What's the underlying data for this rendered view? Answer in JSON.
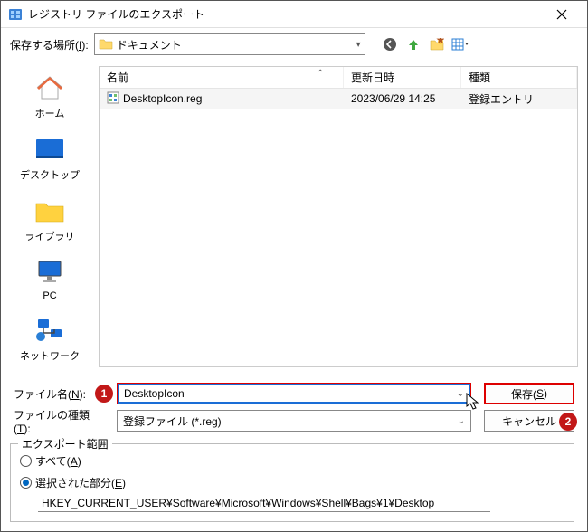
{
  "window": {
    "title": "レジストリ ファイルのエクスポート"
  },
  "toolbar": {
    "location_label_pre": "保存する場所(",
    "location_label_key": "I",
    "location_label_post": "):",
    "location_value": "ドキュメント"
  },
  "places": {
    "home": "ホーム",
    "desktop": "デスクトップ",
    "libraries": "ライブラリ",
    "pc": "PC",
    "network": "ネットワーク"
  },
  "filelist": {
    "col_name": "名前",
    "col_date": "更新日時",
    "col_type": "種類",
    "rows": [
      {
        "name": "DesktopIcon.reg",
        "date": "2023/06/29  14:25",
        "type": "登録エントリ"
      }
    ]
  },
  "form": {
    "filename_label_pre": "ファイル名(",
    "filename_label_key": "N",
    "filename_label_post": "):",
    "filename_value": "DesktopIcon",
    "filetype_label_pre": "ファイルの種類(",
    "filetype_label_key": "T",
    "filetype_label_post": "):",
    "filetype_value": "登録ファイル (*.reg)",
    "save_btn_pre": "保存(",
    "save_btn_key": "S",
    "save_btn_post": ")",
    "cancel_btn": "キャンセル"
  },
  "export": {
    "legend": "エクスポート範囲",
    "all_pre": "すべて(",
    "all_key": "A",
    "all_post": ")",
    "selected_pre": "選択された部分(",
    "selected_key": "E",
    "selected_post": ")",
    "selected_checked": true,
    "path": "HKEY_CURRENT_USER¥Software¥Microsoft¥Windows¥Shell¥Bags¥1¥Desktop"
  },
  "badges": {
    "one": "1",
    "two": "2"
  }
}
